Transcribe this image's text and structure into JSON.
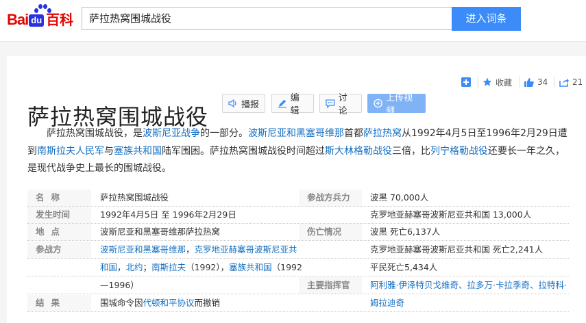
{
  "header": {
    "logo": {
      "bai": "Bai",
      "du": "du",
      "baike": "百科"
    },
    "search_value": "萨拉热窝围城战役",
    "search_button": "进入词条"
  },
  "toolbar": {
    "favorite_label": "收藏",
    "like_count": "34",
    "share_count": "21"
  },
  "title": "萨拉热窝围城战役",
  "actions": {
    "play": "播报",
    "edit": "编辑",
    "discuss": "讨论",
    "upload": "上传视频"
  },
  "summary": {
    "s1": "萨拉热窝围城战役，是",
    "l1": "波斯尼亚战争",
    "s2": "的一部分。",
    "l2": "波斯尼亚和黑塞哥维那",
    "s3": "首都",
    "l3": "萨拉热窝",
    "s4": "从1992年4月5日至1996年2月29日遭到",
    "l4": "南斯拉夫人民军",
    "s5": "与",
    "l5": "塞族共和国",
    "s6": "陆军围困。萨拉热窝围城战役时间超过",
    "l6": "斯大林格勒战役",
    "s7": "三倍，比",
    "l7": "列宁格勒战役",
    "s8": "还要长一年之久，是现代战争史上最长的围城战役。"
  },
  "infobox": {
    "name_label": "名称",
    "name_value": "萨拉热窝围城战役",
    "time_label": "发生时间",
    "time_value": "1992年4月5日 至 1996年2月29日",
    "place_label": "地点",
    "place_value": "波斯尼亚和黑塞哥维那萨拉热窝",
    "sides_label": "参战方",
    "sides_l1": "波斯尼亚和黑塞哥维那",
    "sides_t1": "，",
    "sides_l2": "克罗地亚赫塞哥波斯尼亚共",
    "sides_l3": "和国",
    "sides_t2": "，",
    "sides_l4": "北约",
    "sides_t3": "；",
    "sides_l5": "南斯拉夫",
    "sides_t4": "（1992），",
    "sides_l6": "塞族共和国",
    "sides_t5": "（1992",
    "sides_t6": "—1996）",
    "result_label": "结果",
    "result_pre": "围城命令因",
    "result_link": "代顿和平协议",
    "result_post": "而撤销",
    "strength_label": "参战方兵力",
    "strength_v1": "波黑 70,000人",
    "strength_v2": "克罗地亚赫塞哥波斯尼亚共和国 13,000人",
    "casualty_label": "伤亡情况",
    "casualty_v1": "波黑 死亡6,137人",
    "casualty_v2": "克罗地亚赫塞哥波斯尼亚共和国 死亡2,241人",
    "casualty_v3": "平民死亡5,434人",
    "commander_label": "主要指挥官",
    "commander_v1": "阿利雅·伊泽特贝戈维奇、拉多万·卡拉季奇、拉特科·",
    "commander_v2": "姆拉迪奇"
  },
  "colors": {
    "link": "#136ec2",
    "search_button": "#3b8cf8",
    "brand_red": "#e10602",
    "brand_blue": "#2932e1"
  }
}
